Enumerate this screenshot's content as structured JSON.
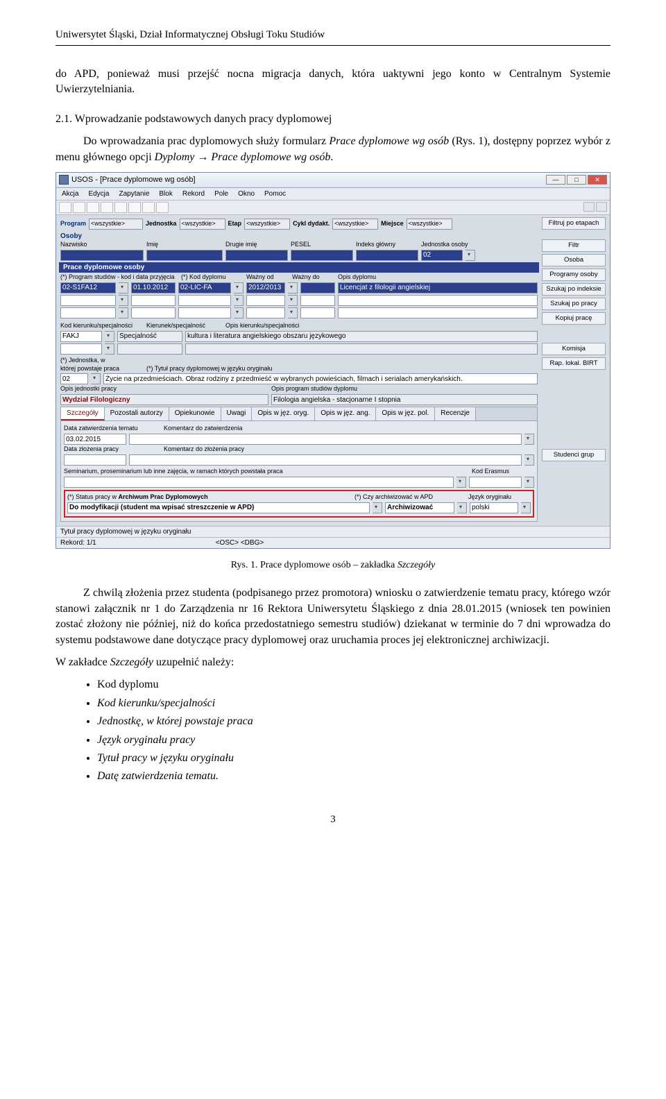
{
  "header": "Uniwersytet Śląski, Dział Informatycznej Obsługi Toku Studiów",
  "intro_para": "do APD, ponieważ musi przejść nocna migracja danych, która uaktywni jego konto w Centralnym Systemie Uwierzytelniania.",
  "section_num": "2.1. Wprowadzanie podstawowych danych pracy dyplomowej",
  "para2a": "Do wprowadzania prac dyplomowych służy formularz ",
  "para2b": "Prace dyplomowe wg osób",
  "para2c": " (Rys. 1), dostępny poprzez wybór z menu głównego opcji ",
  "para2d": "Dyplomy → Prace dyplomowe wg osób",
  "para2e": ".",
  "fig_caption_a": "Rys. 1. Prace dyplomowe osób – zakładka ",
  "fig_caption_b": "Szczegóły",
  "para3": "Z chwilą złożenia przez studenta (podpisanego przez promotora) wniosku o zatwierdzenie tematu pracy, którego wzór stanowi załącznik nr 1 do Zarządzenia nr 16 Rektora Uniwersytetu Śląskiego z dnia 28.01.2015 (wniosek ten powinien zostać złożony nie później, niż do końca przedostatniego semestru studiów) dziekanat w terminie do 7 dni wprowadza do systemu podstawowe dane dotyczące pracy dyplomowej oraz uruchamia proces jej elektronicznej archiwizacji.",
  "para4a": "W zakładce ",
  "para4b": "Szczegóły",
  "para4c": " uzupełnić należy:",
  "bullets": [
    "Kod dyplomu",
    "Kod kierunku/specjalności",
    "Jednostkę, w której powstaje praca",
    "Język oryginału pracy",
    "Tytuł pracy w języku oryginału",
    "Datę zatwierdzenia tematu."
  ],
  "page_number": "3",
  "app": {
    "title": "USOS - [Prace dyplomowe wg osób]",
    "menu": [
      "Akcja",
      "Edycja",
      "Zapytanie",
      "Blok",
      "Rekord",
      "Pole",
      "Okno",
      "Pomoc"
    ],
    "filters": {
      "program_lbl": "Program",
      "program_val": "<wszystkie>",
      "jednostka_lbl": "Jednostka",
      "jednostka_val": "<wszystkie>",
      "etap_lbl": "Etap",
      "etap_val": "<wszystkie>",
      "cykl_lbl": "Cykl dydakt.",
      "cykl_val": "<wszystkie>",
      "miejsce_lbl": "Miejsce",
      "miejsce_val": "<wszystkie>",
      "filtr_btn": "Filtruj po etapach"
    },
    "osoby": {
      "title": "Osoby",
      "cols": [
        "Nazwisko",
        "Imię",
        "Drugie imię",
        "PESEL",
        "Indeks główny",
        "Jednostka osoby"
      ],
      "jedn_val": "02"
    },
    "side_buttons": [
      "Filtr",
      "Osoba",
      "Programy osoby",
      "Szukaj po indeksie",
      "Szukaj po pracy",
      "Kopiuj pracę",
      "",
      "Komisja",
      "Rap. lokal. BIRT",
      "",
      "",
      "",
      "",
      "Studenci grup"
    ],
    "prace": {
      "title": "Prace dyplomowe osoby",
      "cols": [
        "(*) Program studiów - kod i data przyjęcia",
        "(*) Kod dyplomu",
        "Ważny od",
        "Ważny do",
        "Opis dyplomu"
      ],
      "r1": {
        "prog": "02-S1FA12",
        "date": "01.10.2012",
        "koddypl": "02-LIC-FA",
        "wazod": "2012/2013",
        "opis": "Licencjat z filologii angielskiej"
      }
    },
    "kier": {
      "lbls": [
        "Kod kierunku/specjalności",
        "Kierunek/specjalność",
        "Opis kierunku/specjalności"
      ],
      "kod": "FAKJ",
      "typ": "Specjalność",
      "opis": "kultura i literatura angielskiego obszaru językowego"
    },
    "jedn": {
      "lbl_a": "(*) Jednostka, w",
      "lbl_b": "której powstaje praca",
      "lbl_c": "(*) Tytuł pracy dyplomowej w języku oryginału",
      "kod": "02",
      "tytul": "Życie na przedmieściach. Obraz rodziny z przedmieść w wybranych powieściach, filmach i serialach amerykańskich.",
      "lbl_d": "Opis jednostki pracy",
      "lbl_e": "Opis program studiów dyplomu",
      "opis_jedn": "Wydział Filologiczny",
      "opis_prog": "Filologia angielska - stacjonarne I stopnia"
    },
    "tabs": [
      "Szczegóły",
      "Pozostali autorzy",
      "Opiekunowie",
      "Uwagi",
      "Opis w jęz. oryg.",
      "Opis w jęz. ang.",
      "Opis w jęz. pol.",
      "Recenzje"
    ],
    "det": {
      "datazatw_lbl": "Data zatwierdzenia tematu",
      "datazatw": "03.02.2015",
      "komzatw_lbl": "Komentarz do zatwierdzenia",
      "datazloz_lbl": "Data złożenia pracy",
      "komzloz_lbl": "Komentarz do złożenia pracy",
      "sem_lbl": "Seminarium, proseminarium lub inne zajęcia, w ramach których powstała praca",
      "erasmus_lbl": "Kod Erasmus",
      "status_lbl": "(*) Status pracy w",
      "status_lbl2": "Archiwum Prac Dyplomowych",
      "status_val": "Do modyfikacji (student ma wpisać streszczenie w APD)",
      "arch_lbl": "(*) Czy archiwizować w APD",
      "arch_val": "Archiwizować",
      "jezyk_lbl": "Język oryginału",
      "jezyk_val": "polski"
    },
    "footer": {
      "tytul_lbl": "Tytuł pracy dyplomowej w języku oryginału",
      "rekord": "Rekord: 1/1",
      "osc": "<OSC> <DBG>"
    }
  }
}
